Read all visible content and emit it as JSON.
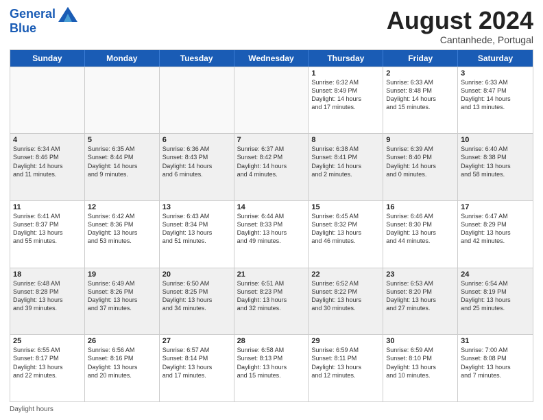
{
  "header": {
    "logo_line1": "General",
    "logo_line2": "Blue",
    "month_title": "August 2024",
    "subtitle": "Cantanhede, Portugal"
  },
  "days_of_week": [
    "Sunday",
    "Monday",
    "Tuesday",
    "Wednesday",
    "Thursday",
    "Friday",
    "Saturday"
  ],
  "footer": {
    "daylight_label": "Daylight hours"
  },
  "rows": [
    {
      "alt": false,
      "cells": [
        {
          "day": "",
          "text": ""
        },
        {
          "day": "",
          "text": ""
        },
        {
          "day": "",
          "text": ""
        },
        {
          "day": "",
          "text": ""
        },
        {
          "day": "1",
          "text": "Sunrise: 6:32 AM\nSunset: 8:49 PM\nDaylight: 14 hours\nand 17 minutes."
        },
        {
          "day": "2",
          "text": "Sunrise: 6:33 AM\nSunset: 8:48 PM\nDaylight: 14 hours\nand 15 minutes."
        },
        {
          "day": "3",
          "text": "Sunrise: 6:33 AM\nSunset: 8:47 PM\nDaylight: 14 hours\nand 13 minutes."
        }
      ]
    },
    {
      "alt": true,
      "cells": [
        {
          "day": "4",
          "text": "Sunrise: 6:34 AM\nSunset: 8:46 PM\nDaylight: 14 hours\nand 11 minutes."
        },
        {
          "day": "5",
          "text": "Sunrise: 6:35 AM\nSunset: 8:44 PM\nDaylight: 14 hours\nand 9 minutes."
        },
        {
          "day": "6",
          "text": "Sunrise: 6:36 AM\nSunset: 8:43 PM\nDaylight: 14 hours\nand 6 minutes."
        },
        {
          "day": "7",
          "text": "Sunrise: 6:37 AM\nSunset: 8:42 PM\nDaylight: 14 hours\nand 4 minutes."
        },
        {
          "day": "8",
          "text": "Sunrise: 6:38 AM\nSunset: 8:41 PM\nDaylight: 14 hours\nand 2 minutes."
        },
        {
          "day": "9",
          "text": "Sunrise: 6:39 AM\nSunset: 8:40 PM\nDaylight: 14 hours\nand 0 minutes."
        },
        {
          "day": "10",
          "text": "Sunrise: 6:40 AM\nSunset: 8:38 PM\nDaylight: 13 hours\nand 58 minutes."
        }
      ]
    },
    {
      "alt": false,
      "cells": [
        {
          "day": "11",
          "text": "Sunrise: 6:41 AM\nSunset: 8:37 PM\nDaylight: 13 hours\nand 55 minutes."
        },
        {
          "day": "12",
          "text": "Sunrise: 6:42 AM\nSunset: 8:36 PM\nDaylight: 13 hours\nand 53 minutes."
        },
        {
          "day": "13",
          "text": "Sunrise: 6:43 AM\nSunset: 8:34 PM\nDaylight: 13 hours\nand 51 minutes."
        },
        {
          "day": "14",
          "text": "Sunrise: 6:44 AM\nSunset: 8:33 PM\nDaylight: 13 hours\nand 49 minutes."
        },
        {
          "day": "15",
          "text": "Sunrise: 6:45 AM\nSunset: 8:32 PM\nDaylight: 13 hours\nand 46 minutes."
        },
        {
          "day": "16",
          "text": "Sunrise: 6:46 AM\nSunset: 8:30 PM\nDaylight: 13 hours\nand 44 minutes."
        },
        {
          "day": "17",
          "text": "Sunrise: 6:47 AM\nSunset: 8:29 PM\nDaylight: 13 hours\nand 42 minutes."
        }
      ]
    },
    {
      "alt": true,
      "cells": [
        {
          "day": "18",
          "text": "Sunrise: 6:48 AM\nSunset: 8:28 PM\nDaylight: 13 hours\nand 39 minutes."
        },
        {
          "day": "19",
          "text": "Sunrise: 6:49 AM\nSunset: 8:26 PM\nDaylight: 13 hours\nand 37 minutes."
        },
        {
          "day": "20",
          "text": "Sunrise: 6:50 AM\nSunset: 8:25 PM\nDaylight: 13 hours\nand 34 minutes."
        },
        {
          "day": "21",
          "text": "Sunrise: 6:51 AM\nSunset: 8:23 PM\nDaylight: 13 hours\nand 32 minutes."
        },
        {
          "day": "22",
          "text": "Sunrise: 6:52 AM\nSunset: 8:22 PM\nDaylight: 13 hours\nand 30 minutes."
        },
        {
          "day": "23",
          "text": "Sunrise: 6:53 AM\nSunset: 8:20 PM\nDaylight: 13 hours\nand 27 minutes."
        },
        {
          "day": "24",
          "text": "Sunrise: 6:54 AM\nSunset: 8:19 PM\nDaylight: 13 hours\nand 25 minutes."
        }
      ]
    },
    {
      "alt": false,
      "cells": [
        {
          "day": "25",
          "text": "Sunrise: 6:55 AM\nSunset: 8:17 PM\nDaylight: 13 hours\nand 22 minutes."
        },
        {
          "day": "26",
          "text": "Sunrise: 6:56 AM\nSunset: 8:16 PM\nDaylight: 13 hours\nand 20 minutes."
        },
        {
          "day": "27",
          "text": "Sunrise: 6:57 AM\nSunset: 8:14 PM\nDaylight: 13 hours\nand 17 minutes."
        },
        {
          "day": "28",
          "text": "Sunrise: 6:58 AM\nSunset: 8:13 PM\nDaylight: 13 hours\nand 15 minutes."
        },
        {
          "day": "29",
          "text": "Sunrise: 6:59 AM\nSunset: 8:11 PM\nDaylight: 13 hours\nand 12 minutes."
        },
        {
          "day": "30",
          "text": "Sunrise: 6:59 AM\nSunset: 8:10 PM\nDaylight: 13 hours\nand 10 minutes."
        },
        {
          "day": "31",
          "text": "Sunrise: 7:00 AM\nSunset: 8:08 PM\nDaylight: 13 hours\nand 7 minutes."
        }
      ]
    }
  ]
}
